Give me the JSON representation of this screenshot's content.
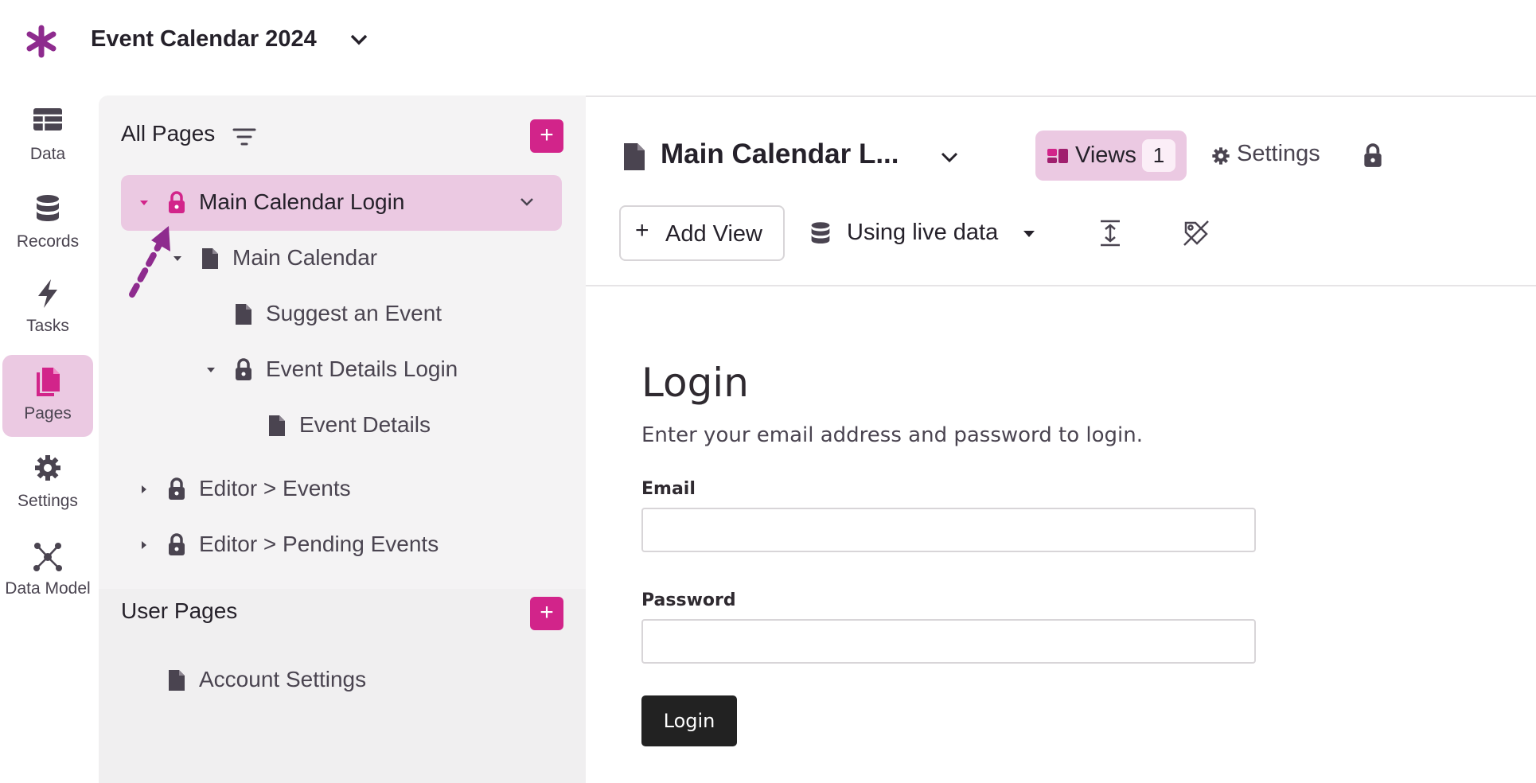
{
  "app": {
    "title": "Event Calendar 2024",
    "accent": "#d2248a",
    "logo_color": "#8e2b8e"
  },
  "leftnav": {
    "items": [
      {
        "label": "Data",
        "icon": "table-icon",
        "active": false
      },
      {
        "label": "Records",
        "icon": "database-icon",
        "active": false
      },
      {
        "label": "Tasks",
        "icon": "lightning-icon",
        "active": false
      },
      {
        "label": "Pages",
        "icon": "pages-icon",
        "active": true
      },
      {
        "label": "Settings",
        "icon": "gear-icon",
        "active": false
      },
      {
        "label": "Data Model",
        "icon": "network-icon",
        "active": false
      }
    ]
  },
  "sidebar": {
    "all_pages_title": "All Pages",
    "tree": [
      {
        "label": "Main Calendar Login",
        "icon": "lock-icon",
        "expanded": true,
        "selected": true
      },
      {
        "label": "Main Calendar",
        "icon": "page-icon",
        "expanded": true
      },
      {
        "label": "Suggest an Event",
        "icon": "page-icon"
      },
      {
        "label": "Event Details Login",
        "icon": "lock-icon",
        "expanded": true
      },
      {
        "label": "Event Details",
        "icon": "page-icon"
      },
      {
        "label": "Editor > Events",
        "icon": "lock-icon",
        "expanded": false
      },
      {
        "label": "Editor > Pending Events",
        "icon": "lock-icon",
        "expanded": false
      }
    ],
    "user_pages_title": "User Pages",
    "user_pages": [
      {
        "label": "Account Settings",
        "icon": "page-icon"
      }
    ]
  },
  "main": {
    "page_title": "Main Calendar L...",
    "views_label": "Views",
    "views_count": "1",
    "settings_label": "Settings",
    "add_view_label": "Add View",
    "data_source_label": "Using live data"
  },
  "login": {
    "heading": "Login",
    "subtitle": "Enter your email address and password to login.",
    "email_label": "Email",
    "email_value": "",
    "password_label": "Password",
    "password_value": "",
    "button_label": "Login"
  }
}
